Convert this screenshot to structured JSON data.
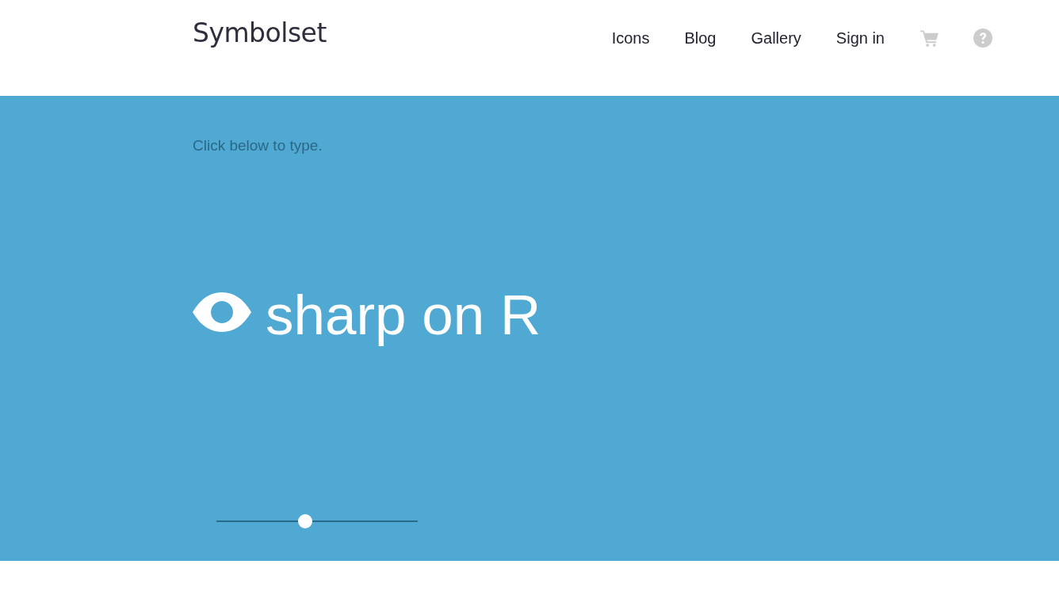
{
  "header": {
    "logo": "Symbolset",
    "nav": [
      {
        "label": "Icons"
      },
      {
        "label": "Blog"
      },
      {
        "label": "Gallery"
      },
      {
        "label": "Sign in"
      }
    ],
    "icons": [
      {
        "kind": "cart"
      },
      {
        "kind": "help"
      }
    ]
  },
  "hero": {
    "hint": "Click below to type.",
    "type_area": {
      "value": "sharp on R"
    },
    "size_slider": {
      "level": 0.44
    }
  }
}
